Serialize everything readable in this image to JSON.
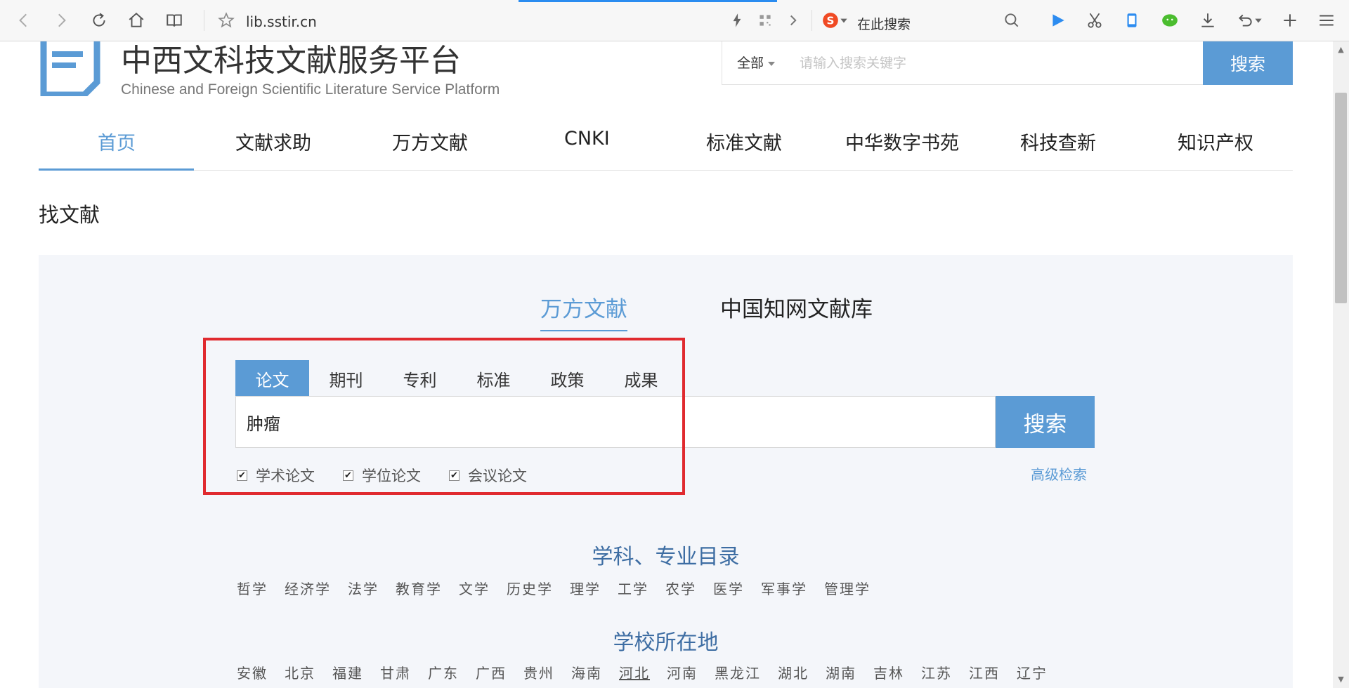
{
  "browser": {
    "address": "lib.sstir.cn",
    "search_placeholder": "在此搜索"
  },
  "site": {
    "title": "中西文科技文献服务平台",
    "subtitle": "Chinese and Foreign Scientific Literature Service Platform",
    "search": {
      "scope": "全部",
      "placeholder": "请输入搜索关键字",
      "button": "搜索"
    }
  },
  "nav": {
    "items": [
      {
        "label": "首页",
        "active": true
      },
      {
        "label": "文献求助"
      },
      {
        "label": "万方文献"
      },
      {
        "label": "CNKI"
      },
      {
        "label": "标准文献"
      },
      {
        "label": "中华数字书苑"
      },
      {
        "label": "科技查新"
      },
      {
        "label": "知识产权"
      }
    ]
  },
  "section": {
    "heading": "找文献"
  },
  "panel": {
    "db_tabs": [
      {
        "label": "万方文献",
        "active": true
      },
      {
        "label": "中国知网文献库"
      }
    ],
    "type_tabs": [
      {
        "label": "论文",
        "active": true
      },
      {
        "label": "期刊"
      },
      {
        "label": "专利"
      },
      {
        "label": "标准"
      },
      {
        "label": "政策"
      },
      {
        "label": "成果"
      }
    ],
    "query": "肿瘤",
    "search_button": "搜索",
    "checkboxes": [
      {
        "label": "学术论文",
        "checked": true
      },
      {
        "label": "学位论文",
        "checked": true
      },
      {
        "label": "会议论文",
        "checked": true
      }
    ],
    "advanced_link": "高级检索",
    "subjects": {
      "heading": "学科、专业目录",
      "items": [
        "哲学",
        "经济学",
        "法学",
        "教育学",
        "文学",
        "历史学",
        "理学",
        "工学",
        "农学",
        "医学",
        "军事学",
        "管理学"
      ]
    },
    "locations": {
      "heading": "学校所在地",
      "items": [
        "安徽",
        "北京",
        "福建",
        "甘肃",
        "广东",
        "广西",
        "贵州",
        "海南",
        "河北",
        "河南",
        "黑龙江",
        "湖北",
        "湖南",
        "吉林",
        "江苏",
        "江西",
        "辽宁"
      ],
      "underlined": "河北"
    }
  },
  "colors": {
    "accent": "#5b9bd5",
    "highlight": "#e02a2f",
    "panel_bg": "#f4f6fa"
  }
}
